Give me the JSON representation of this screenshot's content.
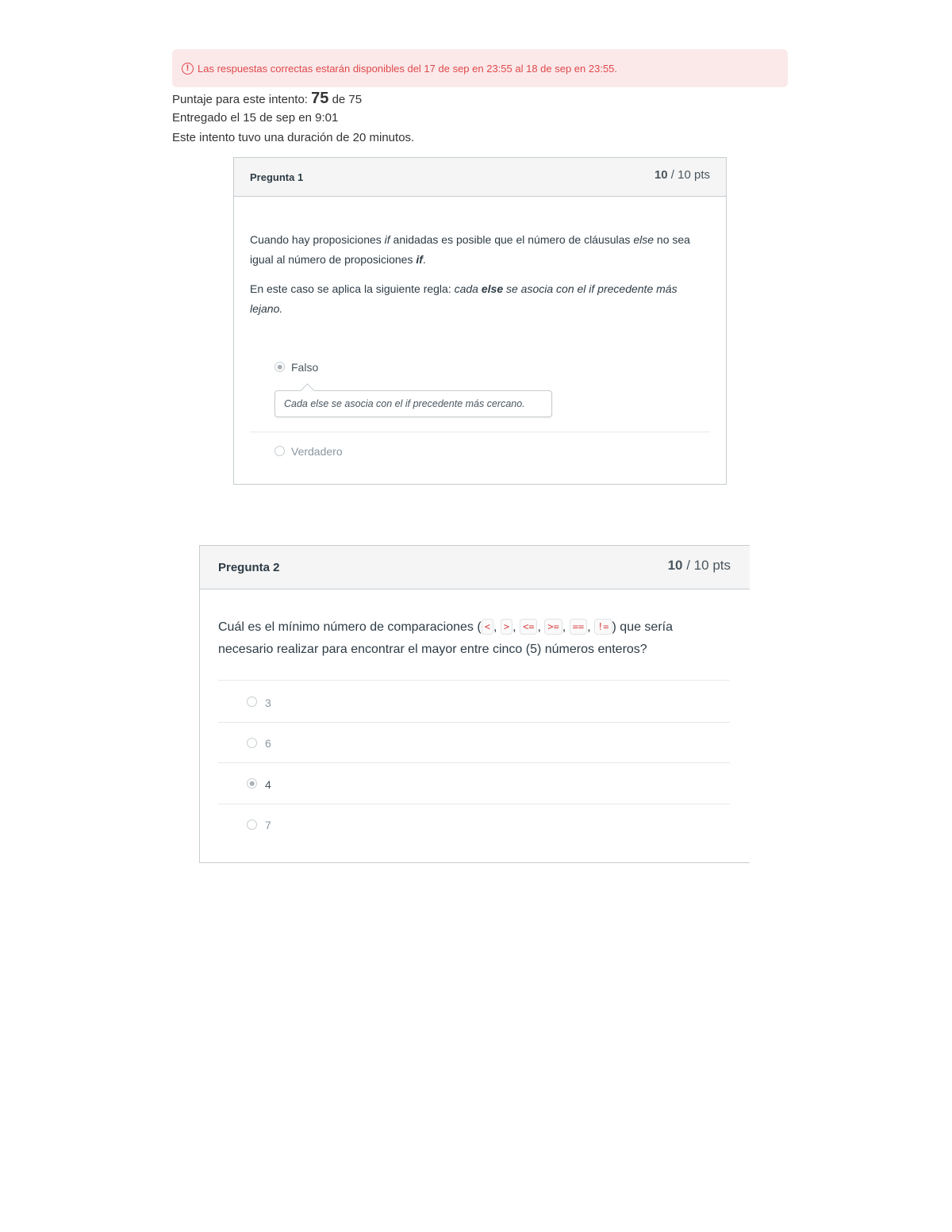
{
  "alert": {
    "icon": "exclamation-circle-icon",
    "text": "Las respuestas correctas estarán disponibles del 17 de sep en 23:55 al 18 de sep en 23:55.",
    "color": "#e0484a"
  },
  "score": {
    "label": "Puntaje para este intento:",
    "value": "75",
    "separator": "de",
    "total": "75"
  },
  "submitted": "Entregado el 15 de sep en 9:01",
  "duration": "Este intento tuvo una duración de 20 minutos.",
  "questions": [
    {
      "title": "Pregunta 1",
      "points": "10",
      "points_total": "/ 10 pts",
      "text": {
        "p1_a": "Cuando hay proposiciones ",
        "p1_if": "if",
        "p1_b": " anidadas es posible que el número de cláusulas ",
        "p1_else": "else",
        "p1_c": " no sea igual al número de proposiciones ",
        "p1_if2": "if",
        "p1_d": ".",
        "p2_a": "En este caso se aplica la siguiente regla: ",
        "p2_b": "cada ",
        "p2_else": "else",
        "p2_c": " se asocia con el if precedente más lejano."
      },
      "answers": [
        {
          "label": "Falso",
          "selected": true
        },
        {
          "label": "Verdadero",
          "selected": false
        }
      ],
      "feedback": "Cada else se asocia con el if precedente más cercano."
    },
    {
      "title": "Pregunta 2",
      "points": "10",
      "points_total": "/ 10 pts",
      "text": {
        "a": "Cuál es el mínimo número de comparaciones (",
        "op1": "<",
        "sep1": ",",
        "op2": ">",
        "sep2": ",",
        "op3": "<=",
        "sep3": ",",
        "op4": ">=",
        "sep4": ",",
        "op5": "==",
        "sep5": ",",
        "op6": "!=",
        "b": ") que sería necesario realizar para encontrar el mayor entre cinco (5) números enteros?"
      },
      "answers": [
        {
          "label": "3",
          "selected": false
        },
        {
          "label": "6",
          "selected": false
        },
        {
          "label": "4",
          "selected": true
        },
        {
          "label": "7",
          "selected": false
        }
      ]
    }
  ]
}
